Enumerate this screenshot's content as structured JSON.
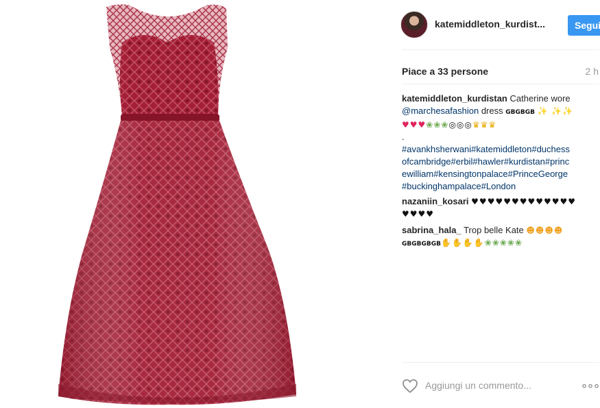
{
  "header": {
    "username": "katemiddleton_kurdist...",
    "follow_label": "Segui"
  },
  "stats": {
    "likes": "Piace a 33 persone",
    "time": "2 h"
  },
  "caption": {
    "user": "katemiddleton_kurdistan",
    "text": " Catherine wore",
    "mention": "@marchesafashion",
    "text2": " dress ",
    "flags": "GBGBGB",
    "emoji_row1": "✨ ✨✨",
    "emoji_hearts": "♥♥♥",
    "emoji_bouquets": "❀❀❀",
    "emoji_rings": "◎◎◎",
    "emoji_crowns": "♛♛♛",
    "dot": ".",
    "hashtags": [
      "#avankhsherwani#katemiddleton#duchess",
      "ofcambridge#erbil#hawler#kurdistan#princ",
      "ewilliam#kensingtonpalace#PrinceGeorge",
      "#buckinghampalace#London"
    ]
  },
  "comments": [
    {
      "user": "nazaniin_kosari",
      "hearts_line1": "♥♥♥♥♥♥♥♥♥♥♥♥♥",
      "hearts_line2": "♥♥♥♥"
    },
    {
      "user": "sabrina_hala_",
      "text": " Trop belle Kate ",
      "faces": "☻☻☻☻",
      "flags": "GBGBGBGB",
      "hands": "✋✋✋✋",
      "bouquets": "❀❀❀❀❀"
    }
  ],
  "footer": {
    "comment_placeholder": "Aggiungi un commento...",
    "like_icon": "heart-outline-icon",
    "more_icon": "ellipsis-icon"
  },
  "colors": {
    "accent": "#3897f0",
    "dress": "#9b1b30",
    "link": "#003569"
  }
}
